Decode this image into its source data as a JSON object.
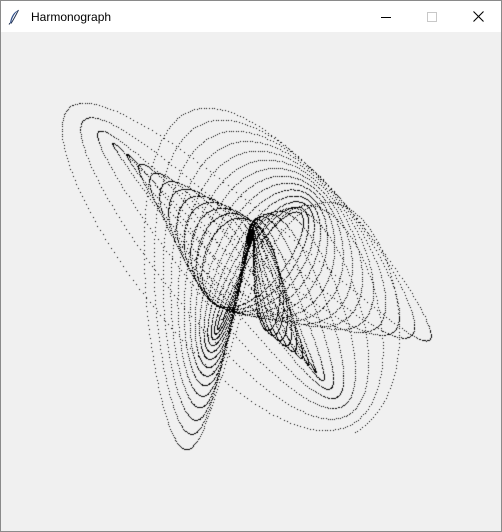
{
  "window": {
    "title": "Harmonograph",
    "app_icon": "feather-icon",
    "controls": {
      "minimize": "minimize-icon",
      "maximize": "maximize-icon",
      "close": "close-icon"
    }
  },
  "canvas": {
    "background": "#f0f0f0",
    "dot_color": "#000000"
  }
}
